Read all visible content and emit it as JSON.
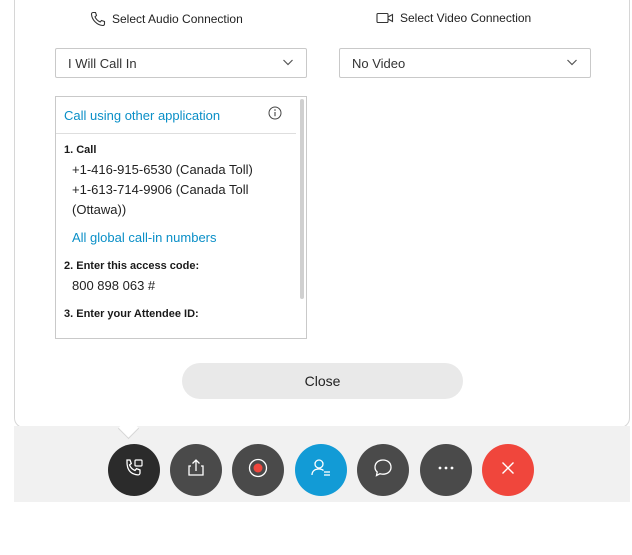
{
  "audio": {
    "header": "Select Audio Connection",
    "selected": "I Will Call In"
  },
  "video": {
    "header": "Select Video Connection",
    "selected": "No Video"
  },
  "call_info": {
    "link_other_app": "Call using other application",
    "step1_title": "1. Call",
    "numbers": [
      "+1-416-915-6530 (Canada Toll)",
      "+1-613-714-9906 (Canada Toll (Ottawa))"
    ],
    "global_link": "All global call-in numbers",
    "step2_title": "2. Enter this access code:",
    "access_code": "800 898 063 #",
    "step3_title": "3. Enter your Attendee ID:"
  },
  "close_label": "Close",
  "toolbar": {
    "buttons": [
      {
        "icon": "audio-connection-icon",
        "color": "#2b2b2b"
      },
      {
        "icon": "share-icon",
        "color": "#4a4a4a"
      },
      {
        "icon": "record-icon",
        "color": "#4a4a4a"
      },
      {
        "icon": "participants-icon",
        "color": "#129bd6"
      },
      {
        "icon": "chat-icon",
        "color": "#4a4a4a"
      },
      {
        "icon": "more-icon",
        "color": "#4a4a4a"
      },
      {
        "icon": "end-meeting-icon",
        "color": "#f0463c"
      }
    ]
  }
}
